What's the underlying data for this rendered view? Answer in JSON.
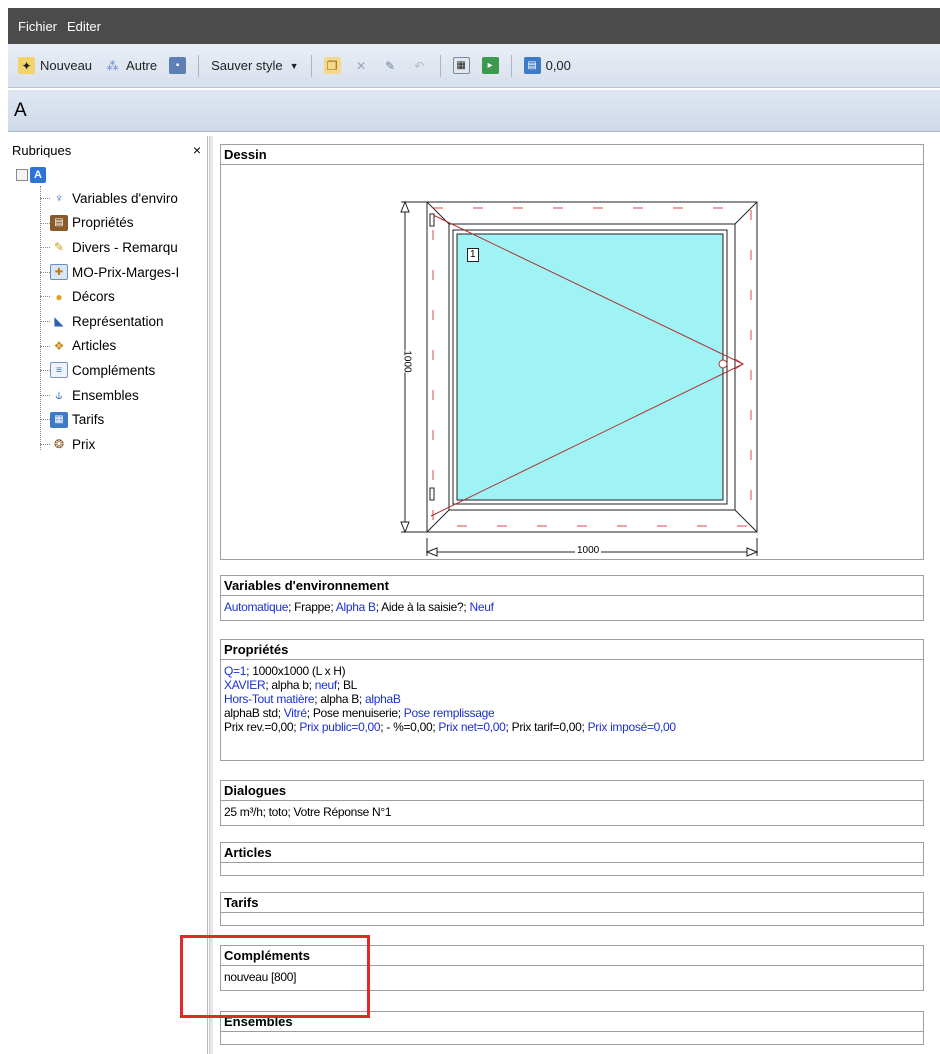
{
  "menu": {
    "items": [
      "Fichier",
      "Editer"
    ]
  },
  "toolbar": {
    "new_label": "Nouveau",
    "other_label": "Autre",
    "save_style_label": "Sauver style",
    "value": "0,00"
  },
  "title": "A",
  "left_panel": {
    "title": "Rubriques",
    "close_glyph": "×",
    "root_label": "A",
    "items": [
      {
        "label": "Variables d'enviro",
        "icon": "environment-icon"
      },
      {
        "label": "Propriétés",
        "icon": "properties-icon"
      },
      {
        "label": "Divers - Remarqu",
        "icon": "misc-notes-icon"
      },
      {
        "label": "MO-Prix-Marges-I",
        "icon": "price-margins-icon"
      },
      {
        "label": "Décors",
        "icon": "palette-icon"
      },
      {
        "label": "Représentation",
        "icon": "drawing-icon"
      },
      {
        "label": "Articles",
        "icon": "articles-icon"
      },
      {
        "label": "Compléments",
        "icon": "complements-icon"
      },
      {
        "label": "Ensembles",
        "icon": "hierarchy-icon"
      },
      {
        "label": "Tarifs",
        "icon": "rates-icon"
      },
      {
        "label": "Prix",
        "icon": "price-icon"
      }
    ]
  },
  "sections": {
    "dessin": {
      "title": "Dessin",
      "width_label": "1000",
      "height_label": "1000",
      "sash_label": "1"
    },
    "variables": {
      "title": "Variables d'environnement",
      "parts": [
        {
          "text": "Automatique",
          "blue": true
        },
        {
          "text": "; Frappe; ",
          "blue": false
        },
        {
          "text": "Alpha B",
          "blue": true
        },
        {
          "text": "; Aide à la saisie?; ",
          "blue": false
        },
        {
          "text": "Neuf",
          "blue": true
        }
      ]
    },
    "proprietes": {
      "title": "Propriétés",
      "lines": [
        [
          {
            "text": "Q=1",
            "blue": true
          },
          {
            "text": "; 1000x1000 (L x H)",
            "blue": false
          }
        ],
        [
          {
            "text": "XAVIER",
            "blue": true
          },
          {
            "text": "; alpha b; ",
            "blue": false
          },
          {
            "text": "neuf",
            "blue": true
          },
          {
            "text": "; BL",
            "blue": false
          }
        ],
        [
          {
            "text": "Hors-Tout matière",
            "blue": true
          },
          {
            "text": "; alpha B; ",
            "blue": false
          },
          {
            "text": "alphaB",
            "blue": true
          }
        ],
        [
          {
            "text": "alphaB std; ",
            "blue": false
          },
          {
            "text": "Vitré",
            "blue": true
          },
          {
            "text": "; Pose menuiserie; ",
            "blue": false
          },
          {
            "text": "Pose remplissage",
            "blue": true
          }
        ],
        [
          {
            "text": "Prix rev.=0,00; ",
            "blue": false
          },
          {
            "text": "Prix public=0,00",
            "blue": true
          },
          {
            "text": "; - %=0,00; ",
            "blue": false
          },
          {
            "text": "Prix net=0,00",
            "blue": true
          },
          {
            "text": "; Prix tarif=0,00; ",
            "blue": false
          },
          {
            "text": "Prix imposé=0,00",
            "blue": true
          }
        ]
      ]
    },
    "dialogues": {
      "title": "Dialogues",
      "text": "25 m³/h; toto; Votre Réponse N°1"
    },
    "articles": {
      "title": "Articles",
      "text": ""
    },
    "tarifs": {
      "title": "Tarifs",
      "text": ""
    },
    "complements": {
      "title": "Compléments",
      "text": "nouveau  [800]"
    },
    "ensembles": {
      "title": "Ensembles",
      "text": ""
    }
  },
  "colors": {
    "glass": "#9ff3f5",
    "frame_line": "#222222",
    "swing_line": "#b03030",
    "highlight": "#e02a2a",
    "link_blue": "#1b2fd6"
  }
}
